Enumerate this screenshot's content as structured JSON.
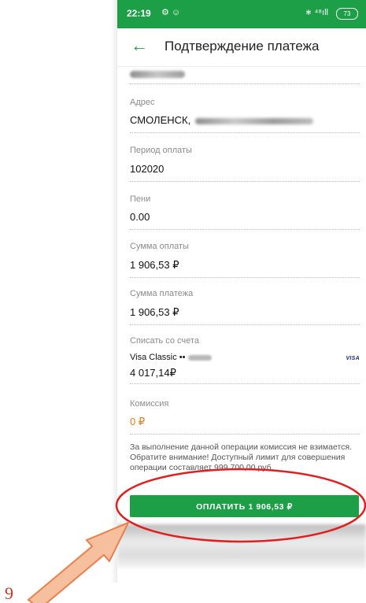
{
  "statusbar": {
    "time": "22:19",
    "left_icons": "⚙ ☺",
    "right_icons": "∗ ⁴⁸ıll",
    "battery": "73"
  },
  "appbar": {
    "back_icon": "←",
    "title": "Подтверждение платежа"
  },
  "fields": {
    "address": {
      "label": "Адрес",
      "value": "СМОЛЕНСК,"
    },
    "period": {
      "label": "Период оплаты",
      "value": "102020"
    },
    "penalty": {
      "label": "Пени",
      "value": "0.00"
    },
    "payment_sum": {
      "label": "Сумма оплаты",
      "value": "1 906,53 ₽"
    },
    "total_sum": {
      "label": "Сумма платежа",
      "value": "1 906,53 ₽"
    },
    "account": {
      "label": "Списать со счета",
      "card_name": "Visa Classic ••",
      "balance": "4 017,14₽",
      "brand": "VISA"
    },
    "commission": {
      "label": "Комиссия",
      "value": "0 ₽"
    }
  },
  "note": {
    "line1": "За выполнение данной операции комиссия не взимается.",
    "line2": "Обратите внимание! Доступный лимит для совершения операции составляет 999 700,00 руб."
  },
  "pay_button": {
    "label": "ОПЛАТИТЬ 1 906,53 ₽"
  },
  "annotation": {
    "step_number": "9"
  },
  "colors": {
    "brand_green": "#1d9f47",
    "commission_orange": "#e07e1b",
    "annotation_red": "#e02020",
    "arrow_fill": "#f6bf9e",
    "arrow_stroke": "#e8804d"
  }
}
